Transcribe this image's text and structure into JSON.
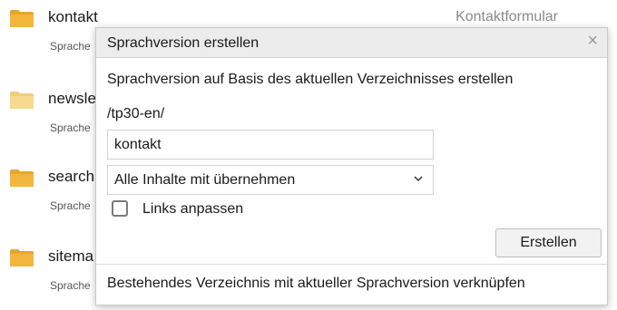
{
  "list": {
    "items": [
      {
        "name": "kontakt",
        "sub": "Sprache",
        "desc": "Kontaktformular",
        "folder_color": "#f3b63c"
      },
      {
        "name": "newsle",
        "sub": "Sprache",
        "desc": "",
        "folder_color": "#f7d98f"
      },
      {
        "name": "search",
        "sub": "Sprache",
        "desc": "",
        "folder_color": "#f3b63c"
      },
      {
        "name": "sitema",
        "sub": "Sprache",
        "desc": "",
        "folder_color": "#f3b63c"
      }
    ]
  },
  "dialog": {
    "title": "Sprachversion erstellen",
    "close_icon": "×",
    "description": "Sprachversion auf Basis des aktuellen Verzeichnisses erstellen",
    "path": "/tp30-en/",
    "name_value": "kontakt",
    "select_value": "Alle Inhalte mit übernehmen",
    "checkbox_label": "Links anpassen",
    "checkbox_checked": false,
    "create_button": "Erstellen",
    "link_text": "Bestehendes Verzeichnis mit aktueller Sprachversion verknüpfen"
  }
}
